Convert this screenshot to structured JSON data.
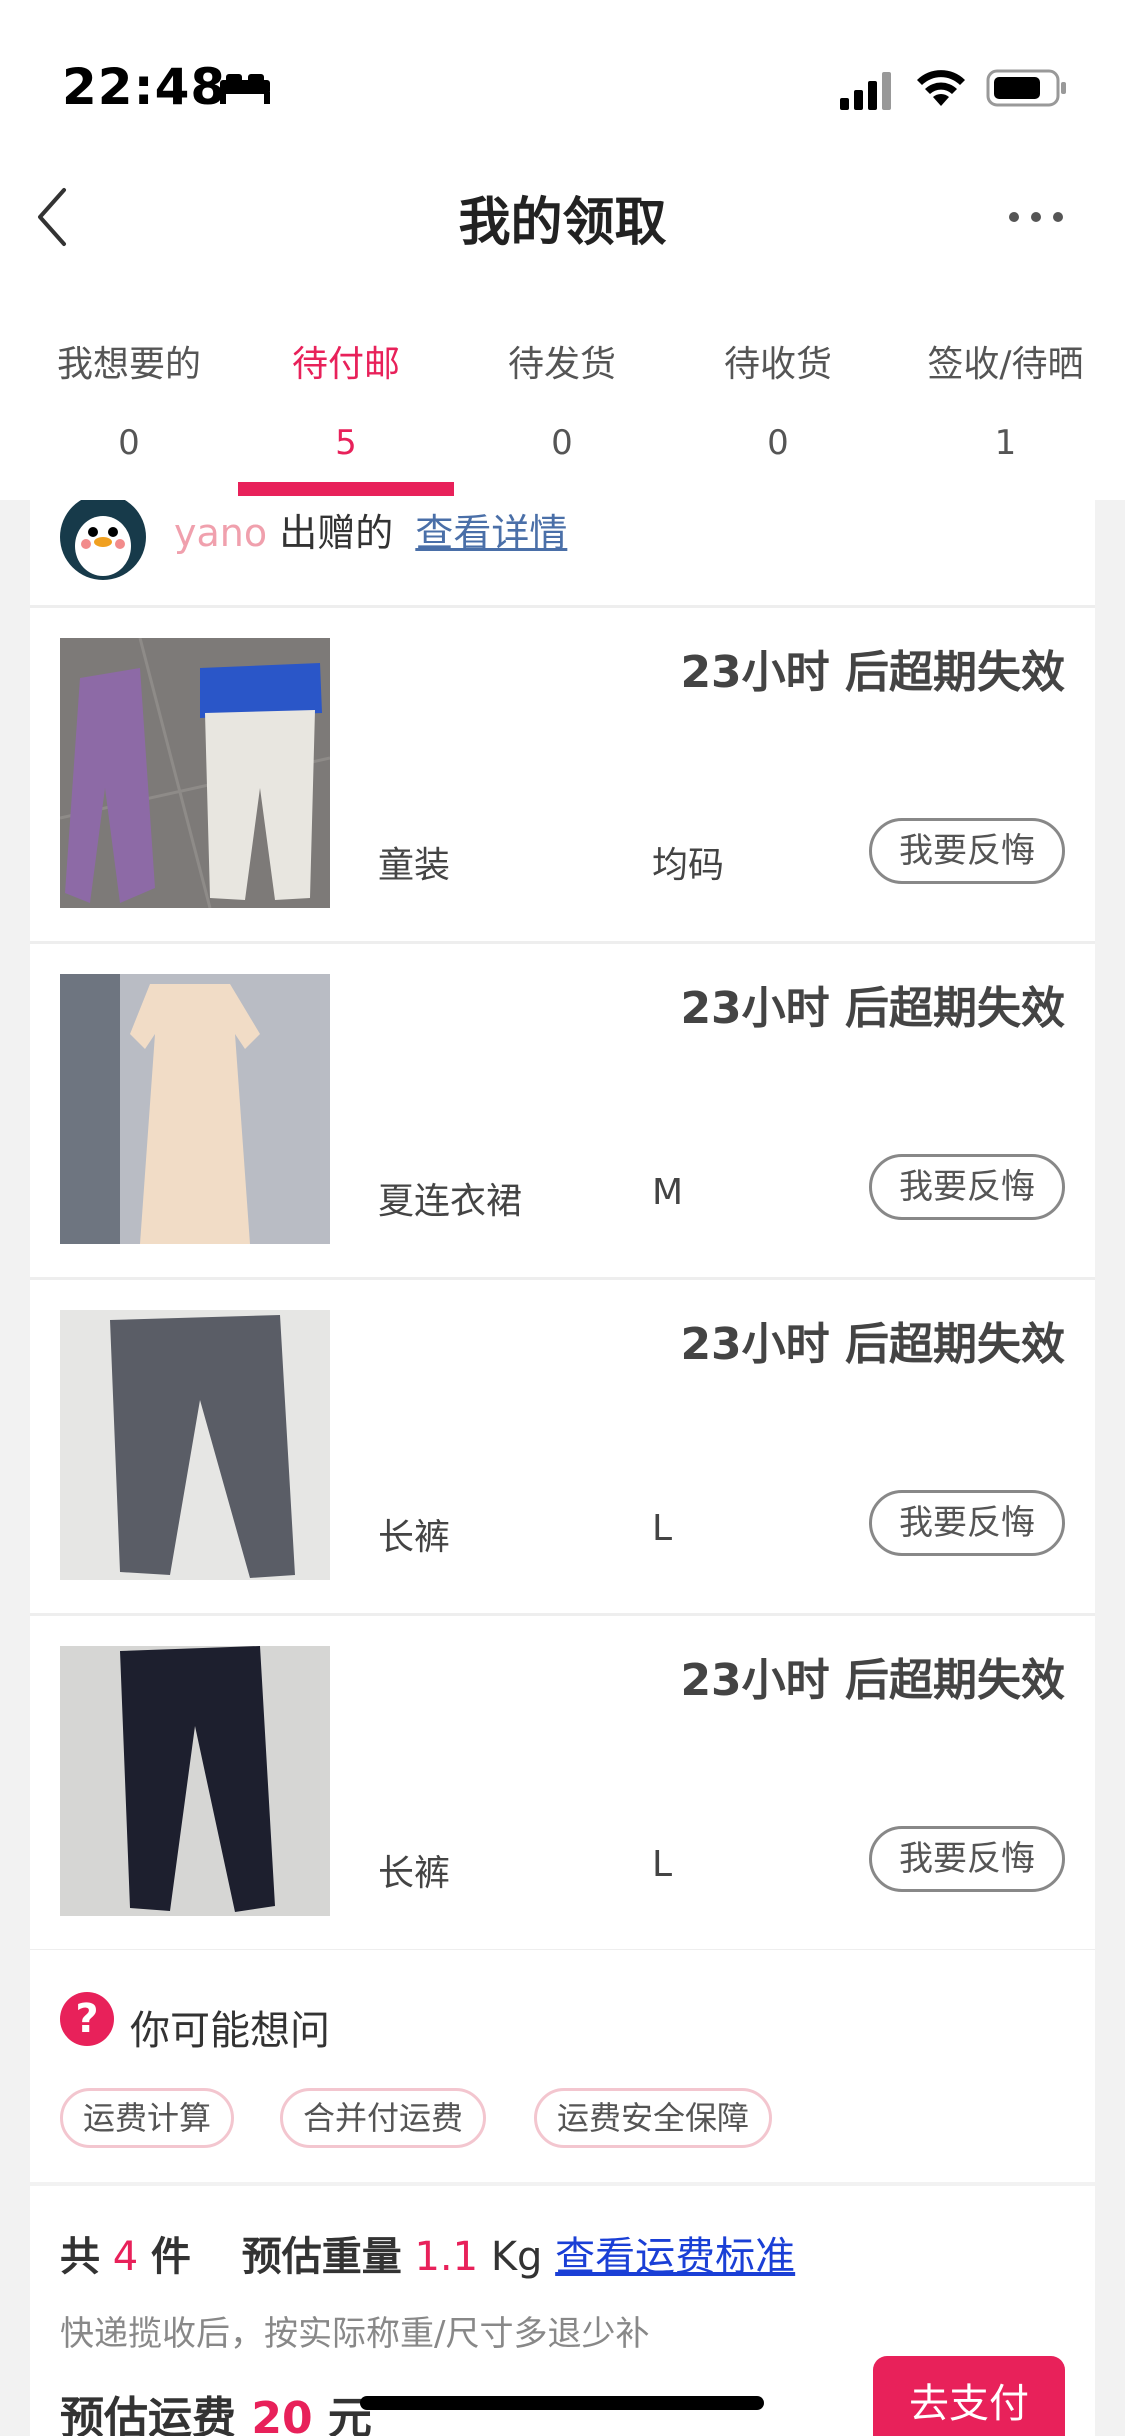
{
  "status_bar": {
    "time": "22:48",
    "icons": [
      "bed-icon",
      "signal-icon",
      "wifi-icon",
      "battery-icon"
    ]
  },
  "nav": {
    "title": "我的领取",
    "back_icon": "back-icon",
    "more_icon": "more-icon"
  },
  "tabs": [
    {
      "label": "我想要的",
      "count": "0",
      "active": false
    },
    {
      "label": "待付邮",
      "count": "5",
      "active": true
    },
    {
      "label": "待发货",
      "count": "0",
      "active": false
    },
    {
      "label": "待收货",
      "count": "0",
      "active": false
    },
    {
      "label": "签收/待晒",
      "count": "1",
      "active": false
    }
  ],
  "giver": {
    "name": "yano",
    "text": "出赠的",
    "link": "查看详情"
  },
  "items": [
    {
      "expire": "23小时 后超期失效",
      "name": "童装",
      "size": "均码",
      "button": "我要反悔"
    },
    {
      "expire": "23小时 后超期失效",
      "name": "夏连衣裙",
      "size": "M",
      "button": "我要反悔"
    },
    {
      "expire": "23小时 后超期失效",
      "name": "长裤",
      "size": "L",
      "button": "我要反悔"
    },
    {
      "expire": "23小时 后超期失效",
      "name": "长裤",
      "size": "L",
      "button": "我要反悔"
    }
  ],
  "faq": {
    "icon": "question-icon",
    "icon_glyph": "?",
    "title": "你可能想问",
    "tags": [
      "运费计算",
      "合并付运费",
      "运费安全保障"
    ]
  },
  "summary": {
    "total_prefix": "共",
    "total_count": "4",
    "total_unit": "件",
    "weight_label": "预估重量",
    "weight_value": "1.1",
    "weight_unit": "Kg",
    "standard_link": "查看运费标准",
    "note": "快递揽收后，按实际称重/尺寸多退少补",
    "fee_label": "预估运费",
    "fee_value": "20",
    "fee_unit": "元",
    "pay_button": "去支付"
  },
  "colors": {
    "accent": "#e8215a",
    "link_blue": "#1a3fd6",
    "giver_link": "#4a6fa8"
  }
}
